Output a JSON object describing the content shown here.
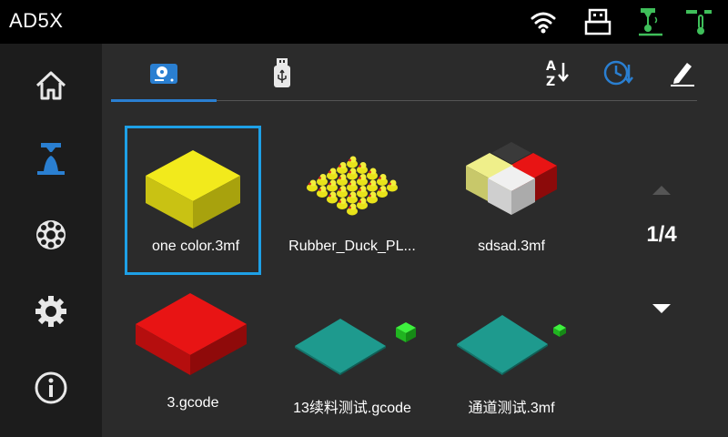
{
  "header": {
    "title": "AD5X",
    "status_icons": [
      "wifi-icon",
      "usb-device-icon",
      "nozzle-temperature-icon",
      "bed-temperature-icon"
    ],
    "status_color": "#3fbf5a"
  },
  "sidebar": {
    "items": [
      {
        "id": "home",
        "icon": "home-icon",
        "active": false
      },
      {
        "id": "print",
        "icon": "print-icon",
        "active": true
      },
      {
        "id": "filament",
        "icon": "filament-spool-icon",
        "active": false
      },
      {
        "id": "settings",
        "icon": "gear-icon",
        "active": false
      },
      {
        "id": "info",
        "icon": "info-icon",
        "active": false
      }
    ],
    "active_color": "#2a7fd1"
  },
  "tabs": [
    {
      "id": "local",
      "icon": "local-storage-icon",
      "active": true
    },
    {
      "id": "usb",
      "icon": "usb-drive-icon",
      "active": false
    }
  ],
  "toolbar": {
    "sort_name_icon": "sort-az-icon",
    "sort_time_icon": "sort-time-icon",
    "edit_icon": "edit-icon"
  },
  "files": [
    {
      "name": "one color.3mf",
      "selected": true,
      "thumbnail": "yellow-cube"
    },
    {
      "name": "Rubber_Duck_PL...",
      "selected": false,
      "thumbnail": "rubber-ducks"
    },
    {
      "name": "sdsad.3mf",
      "selected": false,
      "thumbnail": "four-color-cubes"
    },
    {
      "name": "3.gcode",
      "selected": false,
      "thumbnail": "red-slab"
    },
    {
      "name": "13续料测试.gcode",
      "selected": false,
      "thumbnail": "teal-plate-green-cube"
    },
    {
      "name": "通道测试.3mf",
      "selected": false,
      "thumbnail": "teal-plate-small-green-cube"
    }
  ],
  "pagination": {
    "current": "1/4",
    "up_enabled": false,
    "down_enabled": true
  },
  "colors": {
    "accent": "#2a7fd1",
    "selection": "#1ea0e6"
  }
}
